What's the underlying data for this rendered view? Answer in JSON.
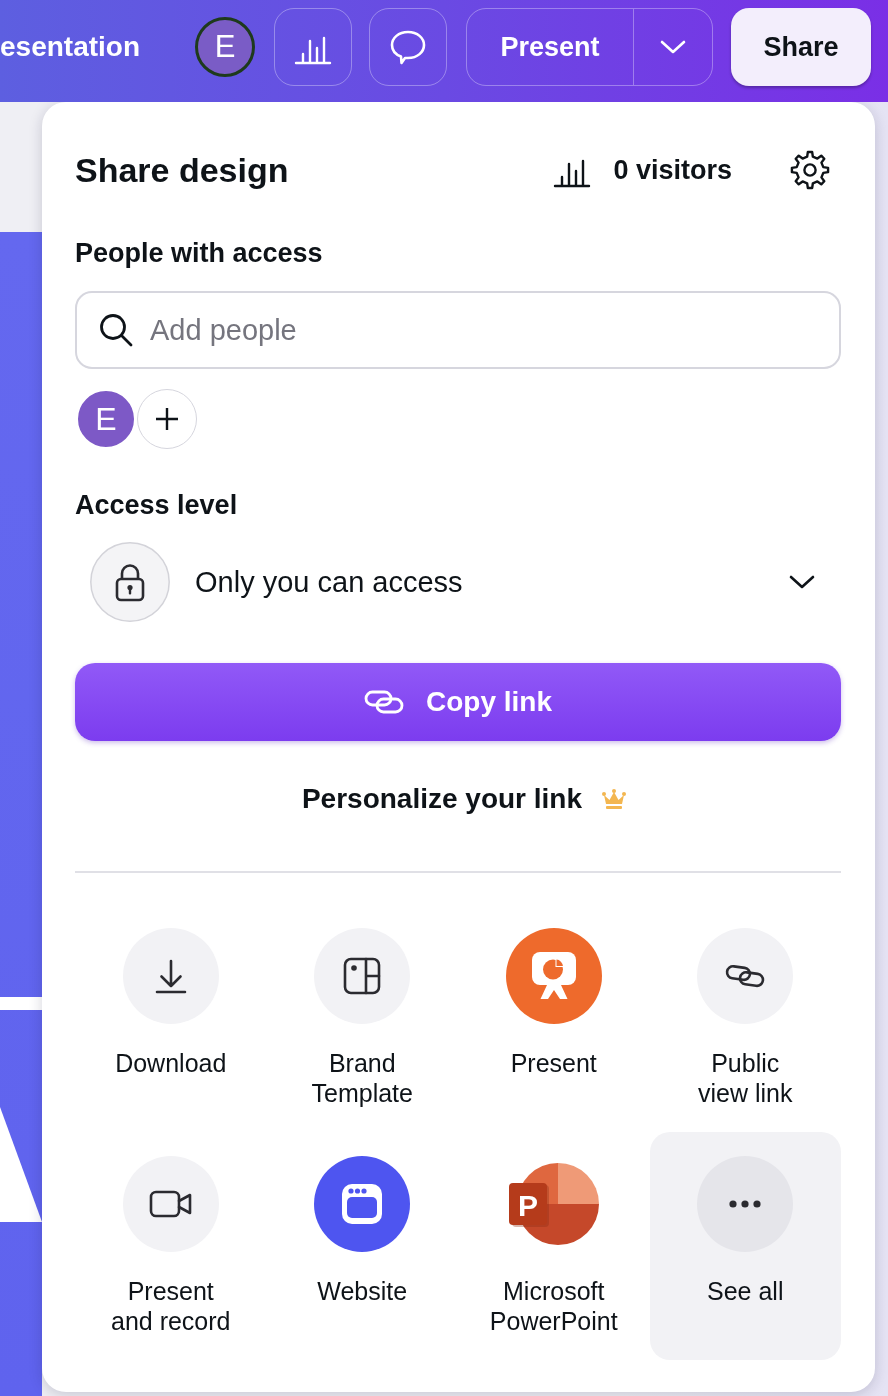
{
  "top_bar": {
    "design_title": "esentation",
    "avatar": {
      "initial": "E"
    },
    "present_button": "Present",
    "share_button": "Share"
  },
  "share_panel": {
    "title": "Share design",
    "visitors": "0 visitors",
    "people_with_access": {
      "heading": "People with access",
      "search": {
        "placeholder": "Add people"
      },
      "people": [
        {
          "initial": "E"
        }
      ]
    },
    "access_level": {
      "heading": "Access level",
      "value": "Only you can access"
    },
    "copy_link_button": "Copy link",
    "personalize_link": {
      "label": "Personalize your link",
      "premium": true
    },
    "options": [
      {
        "kind": "download",
        "label": "Download",
        "highlighted": false
      },
      {
        "kind": "brand_template",
        "label": "Brand\nTemplate",
        "highlighted": false
      },
      {
        "kind": "present",
        "label": "Present",
        "highlighted": false
      },
      {
        "kind": "public_link",
        "label": "Public\nview link",
        "highlighted": false
      },
      {
        "kind": "present_record",
        "label": "Present\nand record",
        "highlighted": false
      },
      {
        "kind": "website",
        "label": "Website",
        "highlighted": false
      },
      {
        "kind": "powerpoint",
        "label": "Microsoft\nPowerPoint",
        "logo_letter": "P",
        "highlighted": false
      },
      {
        "kind": "see_all",
        "label": "See all",
        "highlighted": true
      }
    ]
  }
}
